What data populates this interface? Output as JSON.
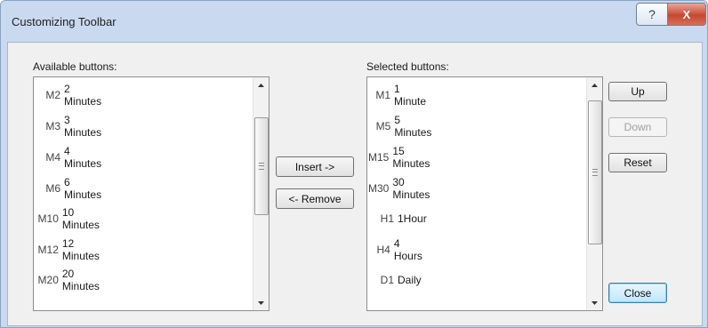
{
  "window": {
    "title": "Customizing Toolbar"
  },
  "titlebar_buttons": {
    "help": "?",
    "close": "X"
  },
  "available": {
    "label": "Available buttons:",
    "items": [
      {
        "code": "M2",
        "name": "2 Minutes"
      },
      {
        "code": "M3",
        "name": "3 Minutes"
      },
      {
        "code": "M4",
        "name": "4 Minutes"
      },
      {
        "code": "M6",
        "name": "6 Minutes"
      },
      {
        "code": "M10",
        "name": "10 Minutes"
      },
      {
        "code": "M12",
        "name": "12 Minutes"
      },
      {
        "code": "M20",
        "name": "20 Minutes"
      }
    ]
  },
  "selected": {
    "label": "Selected buttons:",
    "items": [
      {
        "code": "M1",
        "name": "1 Minute"
      },
      {
        "code": "M5",
        "name": "5 Minutes"
      },
      {
        "code": "M15",
        "name": "15 Minutes"
      },
      {
        "code": "M30",
        "name": "30 Minutes"
      },
      {
        "code": "H1",
        "name": "1Hour"
      },
      {
        "code": "H4",
        "name": "4 Hours"
      },
      {
        "code": "D1",
        "name": "Daily"
      }
    ]
  },
  "actions": {
    "insert": "Insert ->",
    "remove": "<- Remove",
    "up": "Up",
    "down": "Down",
    "reset": "Reset",
    "close": "Close"
  },
  "state": {
    "down_enabled": false,
    "default_button": "close"
  },
  "colors": {
    "titlebar": "#c9daf0",
    "close_button": "#c8482f",
    "client_bg": "#f0f0f0"
  }
}
